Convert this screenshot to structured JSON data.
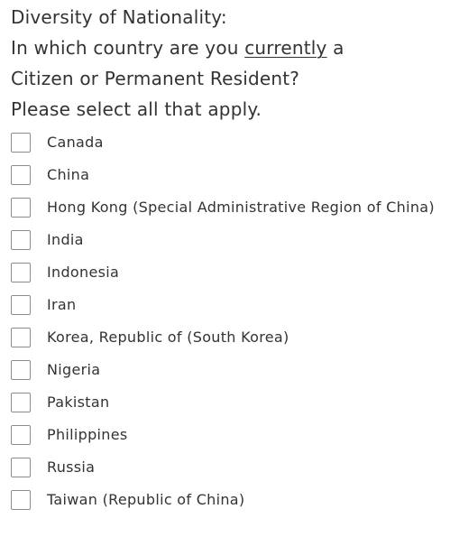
{
  "question": {
    "line1": "Diversity of Nationality:",
    "line2_pre": "In which country are you ",
    "line2_emph": "currently",
    "line2_post": " a",
    "line3": "Citizen or Permanent Resident?",
    "line4": "Please select all that apply."
  },
  "options": [
    {
      "label": "Canada",
      "checked": false
    },
    {
      "label": "China",
      "checked": false
    },
    {
      "label": "Hong Kong (Special Administrative Region of China)",
      "checked": false
    },
    {
      "label": "India",
      "checked": false
    },
    {
      "label": "Indonesia",
      "checked": false
    },
    {
      "label": "Iran",
      "checked": false
    },
    {
      "label": "Korea, Republic of (South Korea)",
      "checked": false
    },
    {
      "label": "Nigeria",
      "checked": false
    },
    {
      "label": "Pakistan",
      "checked": false
    },
    {
      "label": "Philippines",
      "checked": false
    },
    {
      "label": "Russia",
      "checked": false
    },
    {
      "label": "Taiwan (Republic of China)",
      "checked": false
    }
  ],
  "colors": {
    "text": "#333333",
    "checkbox_border": "#8c8c8c",
    "background": "#ffffff"
  }
}
